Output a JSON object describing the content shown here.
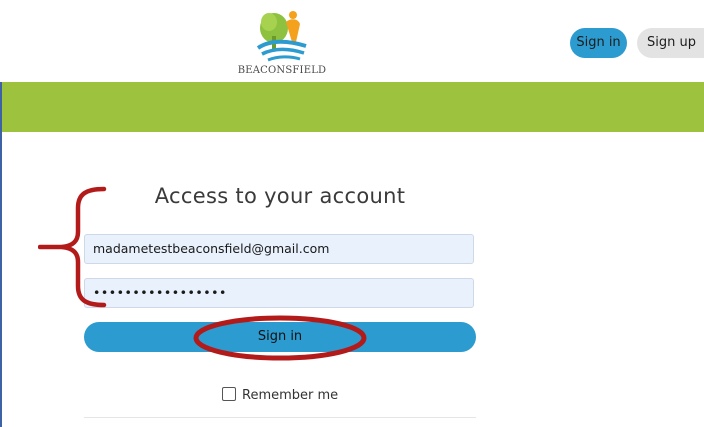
{
  "brand": {
    "name": "BEACONSFIELD",
    "logo_icon": "tree-person-wave-icon"
  },
  "header": {
    "signin_label": "Sign in",
    "signup_label": "Sign up"
  },
  "form": {
    "title": "Access to your account",
    "email_value": "madametestbeaconsfield@gmail.com",
    "password_value": "•••••••••••••••••",
    "signin_label": "Sign in",
    "remember_label": "Remember me",
    "remember_checked": false
  },
  "colors": {
    "accent_blue": "#2c9bd0",
    "band_green": "#9dc23e",
    "annotation_red": "#b31b1b"
  }
}
